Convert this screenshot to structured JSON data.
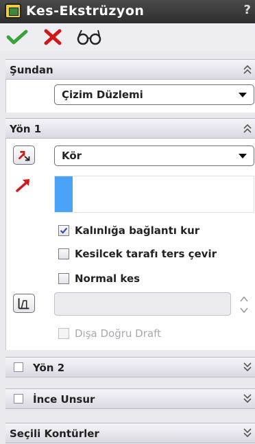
{
  "window": {
    "title": "Kes-Ekstrüzyon",
    "help": "?"
  },
  "actions": {
    "ok_icon": "check-icon",
    "cancel_icon": "close-icon",
    "preview_icon": "glasses-icon"
  },
  "from_group": {
    "title": "Şundan",
    "selected": "Çizim Düzlemi"
  },
  "direction1": {
    "title": "Yön 1",
    "end_condition": "Kör",
    "options": {
      "thin": {
        "label": "Kalınlığa bağlantı kur",
        "checked": true
      },
      "flip": {
        "label": "Kesilcek tarafı ters çevir",
        "checked": false
      },
      "normal": {
        "label": "Normal kes",
        "checked": false
      },
      "draft_outward": {
        "label": "Dışa Doğru Draft",
        "checked": false
      }
    }
  },
  "direction2": {
    "title": "Yön 2"
  },
  "thin_feature": {
    "title": "İnce Unsur"
  },
  "selected_contours": {
    "title": "Seçili Kontürler"
  },
  "colors": {
    "titlebar": "#3a3a3a",
    "accent_blue": "#4aa2f7",
    "ok_green": "#3aa238",
    "cancel_red": "#d01818"
  }
}
